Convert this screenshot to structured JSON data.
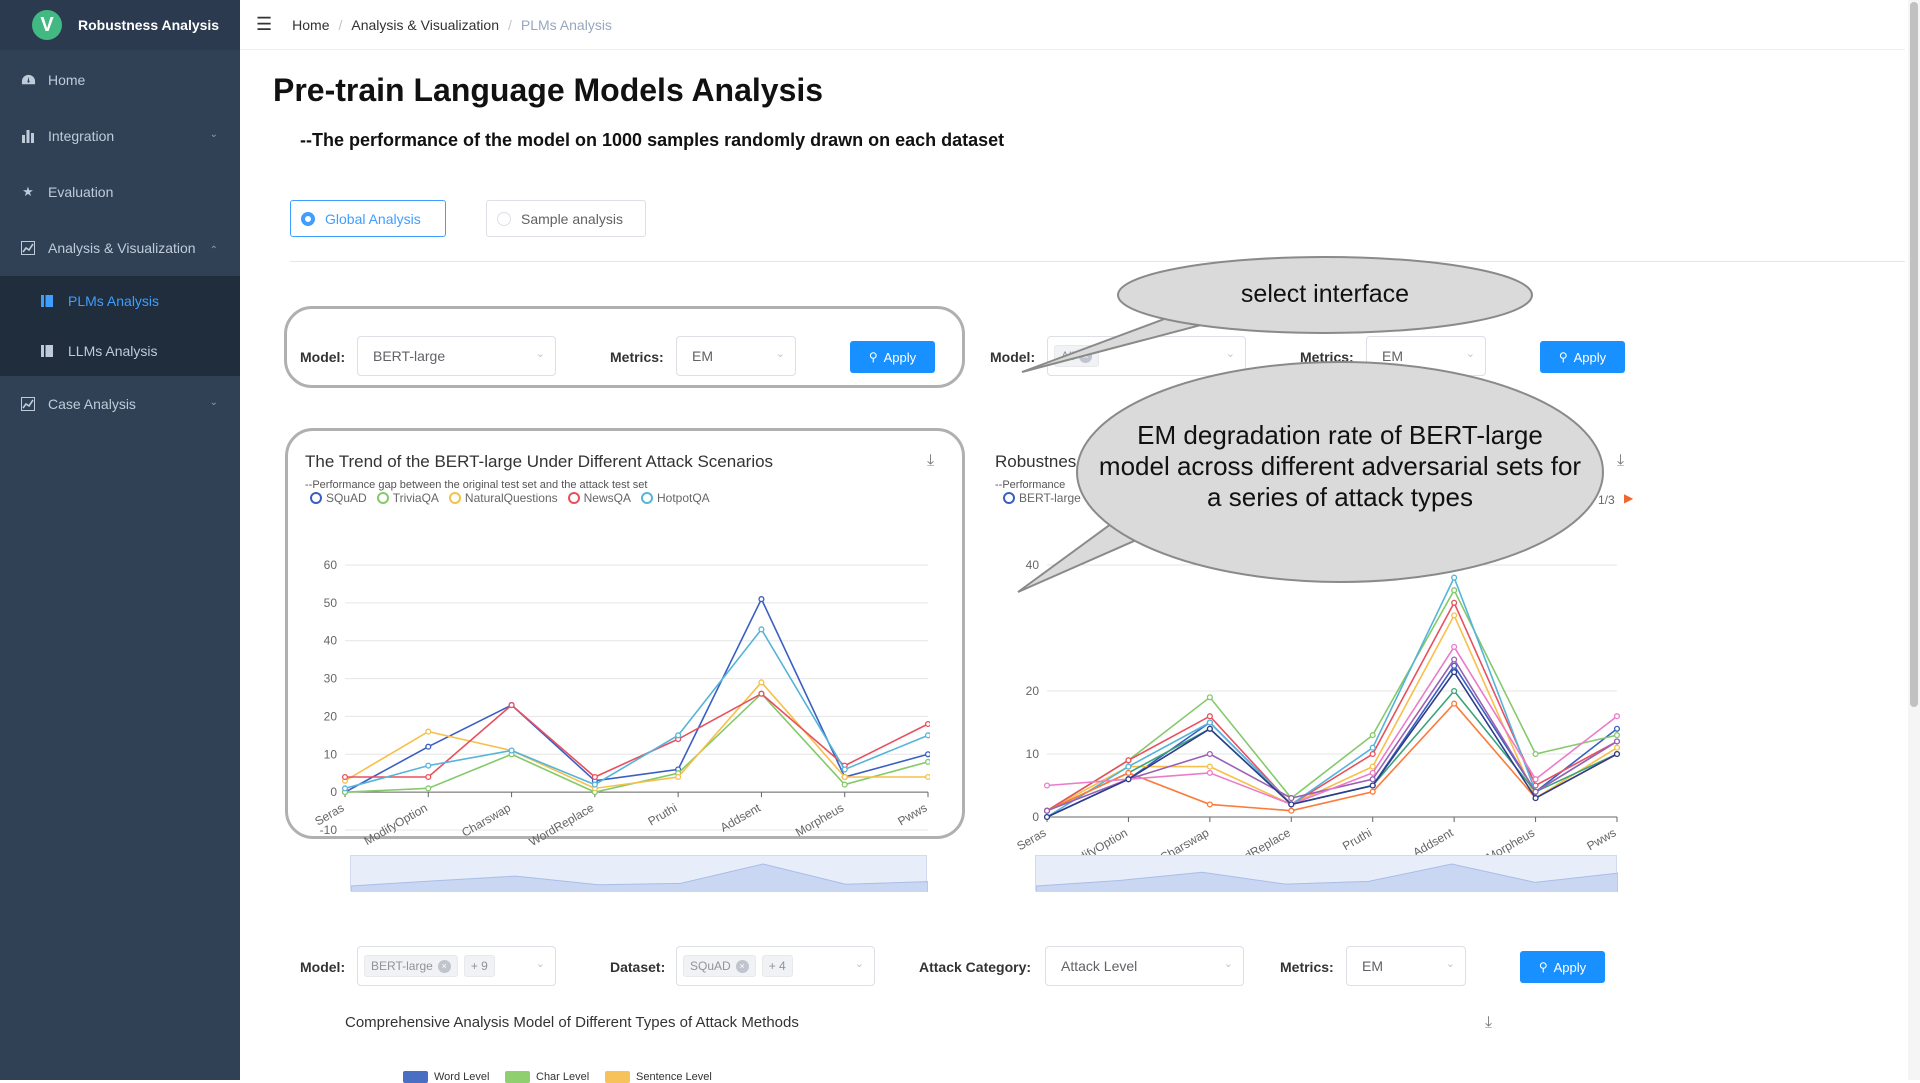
{
  "app": {
    "title": "Robustness Analysis",
    "logo_letter": "V"
  },
  "sidebar": {
    "items": [
      {
        "label": "Home",
        "icon": "dashboard-icon"
      },
      {
        "label": "Integration",
        "icon": "bar-chart-icon"
      },
      {
        "label": "Evaluation",
        "icon": "star-icon"
      },
      {
        "label": "Analysis & Visualization",
        "icon": "line-chart-icon"
      },
      {
        "label": "Case Analysis",
        "icon": "line-chart-icon"
      }
    ],
    "subitems": [
      {
        "label": "PLMs Analysis",
        "icon": "bookmark-icon",
        "active": true
      },
      {
        "label": "LLMs Analysis",
        "icon": "bookmark-icon",
        "active": false
      }
    ]
  },
  "breadcrumb": [
    "Home",
    "Analysis & Visualization",
    "PLMs Analysis"
  ],
  "page": {
    "title": "Pre-train Language Models Analysis",
    "subtitle": "--The performance of the model on 1000 samples randomly drawn on each dataset"
  },
  "tabs": {
    "global": "Global Analysis",
    "sample": "Sample analysis",
    "selected": "global"
  },
  "filters_left": {
    "model_label": "Model:",
    "model_value": "BERT-large",
    "metrics_label": "Metrics:",
    "metrics_value": "EM",
    "apply": "Apply"
  },
  "filters_right": {
    "model_label": "Model:",
    "model_tag": "All",
    "metrics_label": "Metrics:",
    "metrics_value": "EM",
    "apply": "Apply"
  },
  "callouts": {
    "select": "select interface",
    "degradation_line1": "EM degradation rate of BERT-large",
    "degradation_line2": "model across different adversarial sets for",
    "degradation_line3": "a series of attack types"
  },
  "chart_left_text": {
    "title": "The Trend of the BERT-large Under Different Attack Scenarios",
    "subtitle": "--Performance gap between the original test set and the attack test set"
  },
  "chart_right_text": {
    "title": "Robustnes",
    "subtitle": "--Performance",
    "legend_first": "BERT-large",
    "pager": "1/3"
  },
  "filters_bottom": {
    "model_label": "Model:",
    "model_tag": "BERT-large",
    "model_more": "+ 9",
    "dataset_label": "Dataset:",
    "dataset_tag": "SQuAD",
    "dataset_more": "+ 4",
    "attack_label": "Attack Category:",
    "attack_value": "Attack Level",
    "metrics_label": "Metrics:",
    "metrics_value": "EM",
    "apply": "Apply"
  },
  "comprehensive": {
    "title": "Comprehensive Analysis Model of Different Types of Attack Methods",
    "legend": [
      {
        "name": "Word Level",
        "color": "#4a6fc2"
      },
      {
        "name": "Char Level",
        "color": "#8fcf70"
      },
      {
        "name": "Sentence Level",
        "color": "#f8c25a"
      }
    ]
  },
  "chart_data": [
    {
      "type": "line",
      "title": "The Trend of the BERT-large Under Different Attack Scenarios",
      "subtitle": "--Performance gap between the original test set and the attack test set",
      "categories": [
        "Seras",
        "ModifyOption",
        "Charswap",
        "WordReplace",
        "Pruthi",
        "Addsent",
        "Morpheus",
        "Pwws"
      ],
      "ylim": [
        -10,
        60
      ],
      "yticks": [
        -10,
        0,
        10,
        20,
        30,
        40,
        50,
        60
      ],
      "series": [
        {
          "name": "SQuAD",
          "color": "#3a5fc4",
          "values": [
            0,
            12,
            23,
            3,
            6,
            51,
            4,
            10
          ]
        },
        {
          "name": "TriviaQA",
          "color": "#84c96a",
          "values": [
            0,
            1,
            10,
            0,
            5,
            26,
            2,
            8
          ]
        },
        {
          "name": "NaturalQuestions",
          "color": "#f6c04a",
          "values": [
            3,
            16,
            11,
            1,
            4,
            29,
            4,
            4
          ]
        },
        {
          "name": "NewsQA",
          "color": "#e8505e",
          "values": [
            4,
            4,
            23,
            4,
            14,
            26,
            7,
            18
          ]
        },
        {
          "name": "HotpotQA",
          "color": "#55b4d9",
          "values": [
            1,
            7,
            11,
            2,
            15,
            43,
            6,
            15
          ]
        }
      ]
    },
    {
      "type": "line",
      "title": "Robustnes",
      "subtitle": "--Performance",
      "categories": [
        "Seras",
        "ModifyOption",
        "Charswap",
        "WordReplace",
        "Pruthi",
        "Addsent",
        "Morpheus",
        "Pwws"
      ],
      "ylim": [
        0,
        40
      ],
      "yticks": [
        0,
        10,
        20,
        40
      ],
      "series": [
        {
          "name": "BERT-large",
          "color": "#3a5fc4",
          "values": [
            0,
            6,
            15,
            2,
            5,
            24,
            4,
            14
          ]
        },
        {
          "color": "#84c96a",
          "values": [
            1,
            9,
            19,
            3,
            13,
            36,
            10,
            13
          ]
        },
        {
          "color": "#f6c04a",
          "values": [
            1,
            8,
            8,
            2,
            8,
            32,
            3,
            11
          ]
        },
        {
          "color": "#e8505e",
          "values": [
            1,
            9,
            16,
            2,
            10,
            34,
            5,
            12
          ]
        },
        {
          "color": "#55b4d9",
          "values": [
            0,
            8,
            15,
            2,
            11,
            38,
            4,
            12
          ]
        },
        {
          "color": "#3aa37a",
          "values": [
            1,
            7,
            14,
            2,
            5,
            20,
            4,
            10
          ]
        },
        {
          "color": "#fc7a3a",
          "values": [
            1,
            7,
            2,
            1,
            4,
            18,
            3,
            10
          ]
        },
        {
          "color": "#9a60b4",
          "values": [
            1,
            6,
            10,
            3,
            6,
            25,
            4,
            12
          ]
        },
        {
          "color": "#ea7ccc",
          "values": [
            5,
            6,
            7,
            2,
            7,
            27,
            6,
            16
          ]
        },
        {
          "color": "#2d3e8c",
          "values": [
            0,
            6,
            14,
            2,
            5,
            23,
            3,
            10
          ]
        }
      ]
    }
  ]
}
